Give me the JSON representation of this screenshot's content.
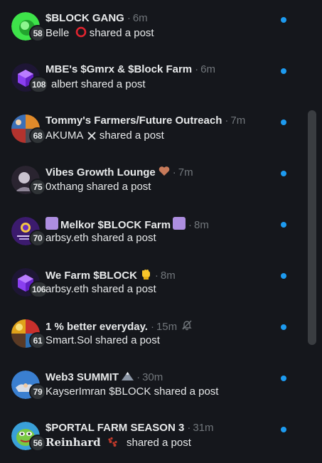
{
  "conversations": [
    {
      "name": "$BLOCK GANG",
      "time": "6m",
      "member_count": "58",
      "sender": "Belle",
      "sender_emoji": "red-circle-icon",
      "action": "shared a post",
      "avatar_color": "#3ee34a",
      "unread": true
    },
    {
      "name": "MBE's $Gmrx & $Block Farm",
      "time": "6m",
      "member_count": "108",
      "sender": "albert",
      "action": "shared a post",
      "avatar_color": "#5b21a6",
      "unread": true
    },
    {
      "name": "Tommy's Farmers/Future Outreach",
      "time": "7m",
      "member_count": "68",
      "sender": "AKUMA",
      "sender_emoji": "x-logo-icon",
      "action": "shared a post",
      "avatar_color": "#3b6fb6",
      "unread": true
    },
    {
      "name": "Vibes Growth Lounge",
      "title_emoji": "brown-heart-icon",
      "time": "7m",
      "member_count": "75",
      "sender": "0xthang",
      "action": "shared a post",
      "avatar_color": "#2a2430",
      "unread": true
    },
    {
      "name": "Melkor $BLOCK Farm",
      "title_emoji": "purple-square-icon",
      "time": "8m",
      "member_count": "70",
      "sender": "arbsy.eth",
      "action": "shared a post",
      "avatar_color": "#3c1b6e",
      "unread": true
    },
    {
      "name": "We Farm $BLOCK",
      "title_emoji": "raised-fist-icon",
      "time": "8m",
      "member_count": "106",
      "sender": "arbsy.eth",
      "action": "shared a post",
      "avatar_color": "#5b21a6",
      "unread": true
    },
    {
      "name": "1 % better everyday.",
      "time": "15m",
      "member_count": "61",
      "sender": "Smart.Sol",
      "action": "shared a post",
      "muted": true,
      "avatar_color": "#e0a21a",
      "unread": true
    },
    {
      "name": "Web3 SUMMIT",
      "title_emoji": "mountain-icon",
      "time": "30m",
      "member_count": "79",
      "sender": "KayserImran $BLOCK",
      "action": "shared a post",
      "avatar_color": "#3a7fd0",
      "unread": true
    },
    {
      "name": "$PORTAL FARM SEASON 3",
      "time": "31m",
      "member_count": "56",
      "sender": "Reinhard",
      "sender_emoji": "paw-prints-icon",
      "action": "shared a post",
      "avatar_color": "#7ac943",
      "unread": true
    }
  ],
  "colors": {
    "accent": "#1d9bf0",
    "background": "#15171c",
    "muted_text": "#71767b"
  }
}
